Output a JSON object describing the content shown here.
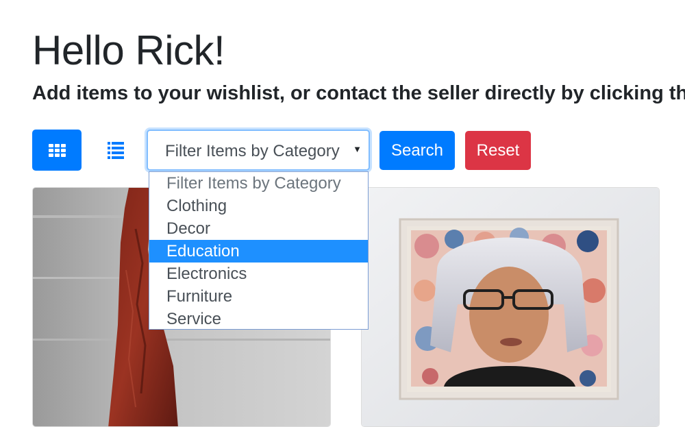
{
  "header": {
    "greeting": "Hello Rick!",
    "subtitle": "Add items to your wishlist, or contact the seller directly by clicking the"
  },
  "toolbar": {
    "grid_view_icon": "grid-icon",
    "list_view_icon": "list-icon",
    "category_select": {
      "selected_value": "Filter Items by Category",
      "options": [
        "Filter Items by Category",
        "Clothing",
        "Decor",
        "Education",
        "Electronics",
        "Furniture",
        "Service"
      ],
      "highlighted_option": "Education"
    },
    "search_label": "Search",
    "reset_label": "Reset"
  },
  "items": [
    {
      "image": "red-dress-photo"
    },
    {
      "image": "framed-portrait-painting"
    }
  ],
  "colors": {
    "primary": "#007bff",
    "danger": "#dc3545",
    "highlight": "#1e90ff"
  }
}
